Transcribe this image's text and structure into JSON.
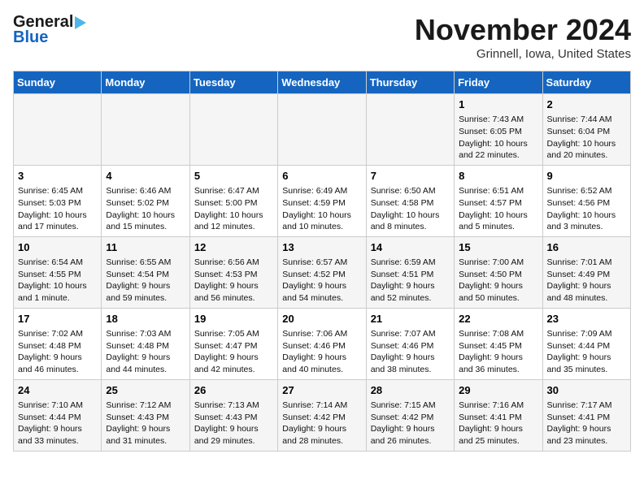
{
  "logo": {
    "line1": "General",
    "line2": "Blue"
  },
  "title": "November 2024",
  "location": "Grinnell, Iowa, United States",
  "days_header": [
    "Sunday",
    "Monday",
    "Tuesday",
    "Wednesday",
    "Thursday",
    "Friday",
    "Saturday"
  ],
  "weeks": [
    [
      {
        "day": "",
        "info": ""
      },
      {
        "day": "",
        "info": ""
      },
      {
        "day": "",
        "info": ""
      },
      {
        "day": "",
        "info": ""
      },
      {
        "day": "",
        "info": ""
      },
      {
        "day": "1",
        "info": "Sunrise: 7:43 AM\nSunset: 6:05 PM\nDaylight: 10 hours\nand 22 minutes."
      },
      {
        "day": "2",
        "info": "Sunrise: 7:44 AM\nSunset: 6:04 PM\nDaylight: 10 hours\nand 20 minutes."
      }
    ],
    [
      {
        "day": "3",
        "info": "Sunrise: 6:45 AM\nSunset: 5:03 PM\nDaylight: 10 hours\nand 17 minutes."
      },
      {
        "day": "4",
        "info": "Sunrise: 6:46 AM\nSunset: 5:02 PM\nDaylight: 10 hours\nand 15 minutes."
      },
      {
        "day": "5",
        "info": "Sunrise: 6:47 AM\nSunset: 5:00 PM\nDaylight: 10 hours\nand 12 minutes."
      },
      {
        "day": "6",
        "info": "Sunrise: 6:49 AM\nSunset: 4:59 PM\nDaylight: 10 hours\nand 10 minutes."
      },
      {
        "day": "7",
        "info": "Sunrise: 6:50 AM\nSunset: 4:58 PM\nDaylight: 10 hours\nand 8 minutes."
      },
      {
        "day": "8",
        "info": "Sunrise: 6:51 AM\nSunset: 4:57 PM\nDaylight: 10 hours\nand 5 minutes."
      },
      {
        "day": "9",
        "info": "Sunrise: 6:52 AM\nSunset: 4:56 PM\nDaylight: 10 hours\nand 3 minutes."
      }
    ],
    [
      {
        "day": "10",
        "info": "Sunrise: 6:54 AM\nSunset: 4:55 PM\nDaylight: 10 hours\nand 1 minute."
      },
      {
        "day": "11",
        "info": "Sunrise: 6:55 AM\nSunset: 4:54 PM\nDaylight: 9 hours\nand 59 minutes."
      },
      {
        "day": "12",
        "info": "Sunrise: 6:56 AM\nSunset: 4:53 PM\nDaylight: 9 hours\nand 56 minutes."
      },
      {
        "day": "13",
        "info": "Sunrise: 6:57 AM\nSunset: 4:52 PM\nDaylight: 9 hours\nand 54 minutes."
      },
      {
        "day": "14",
        "info": "Sunrise: 6:59 AM\nSunset: 4:51 PM\nDaylight: 9 hours\nand 52 minutes."
      },
      {
        "day": "15",
        "info": "Sunrise: 7:00 AM\nSunset: 4:50 PM\nDaylight: 9 hours\nand 50 minutes."
      },
      {
        "day": "16",
        "info": "Sunrise: 7:01 AM\nSunset: 4:49 PM\nDaylight: 9 hours\nand 48 minutes."
      }
    ],
    [
      {
        "day": "17",
        "info": "Sunrise: 7:02 AM\nSunset: 4:48 PM\nDaylight: 9 hours\nand 46 minutes."
      },
      {
        "day": "18",
        "info": "Sunrise: 7:03 AM\nSunset: 4:48 PM\nDaylight: 9 hours\nand 44 minutes."
      },
      {
        "day": "19",
        "info": "Sunrise: 7:05 AM\nSunset: 4:47 PM\nDaylight: 9 hours\nand 42 minutes."
      },
      {
        "day": "20",
        "info": "Sunrise: 7:06 AM\nSunset: 4:46 PM\nDaylight: 9 hours\nand 40 minutes."
      },
      {
        "day": "21",
        "info": "Sunrise: 7:07 AM\nSunset: 4:46 PM\nDaylight: 9 hours\nand 38 minutes."
      },
      {
        "day": "22",
        "info": "Sunrise: 7:08 AM\nSunset: 4:45 PM\nDaylight: 9 hours\nand 36 minutes."
      },
      {
        "day": "23",
        "info": "Sunrise: 7:09 AM\nSunset: 4:44 PM\nDaylight: 9 hours\nand 35 minutes."
      }
    ],
    [
      {
        "day": "24",
        "info": "Sunrise: 7:10 AM\nSunset: 4:44 PM\nDaylight: 9 hours\nand 33 minutes."
      },
      {
        "day": "25",
        "info": "Sunrise: 7:12 AM\nSunset: 4:43 PM\nDaylight: 9 hours\nand 31 minutes."
      },
      {
        "day": "26",
        "info": "Sunrise: 7:13 AM\nSunset: 4:43 PM\nDaylight: 9 hours\nand 29 minutes."
      },
      {
        "day": "27",
        "info": "Sunrise: 7:14 AM\nSunset: 4:42 PM\nDaylight: 9 hours\nand 28 minutes."
      },
      {
        "day": "28",
        "info": "Sunrise: 7:15 AM\nSunset: 4:42 PM\nDaylight: 9 hours\nand 26 minutes."
      },
      {
        "day": "29",
        "info": "Sunrise: 7:16 AM\nSunset: 4:41 PM\nDaylight: 9 hours\nand 25 minutes."
      },
      {
        "day": "30",
        "info": "Sunrise: 7:17 AM\nSunset: 4:41 PM\nDaylight: 9 hours\nand 23 minutes."
      }
    ]
  ]
}
